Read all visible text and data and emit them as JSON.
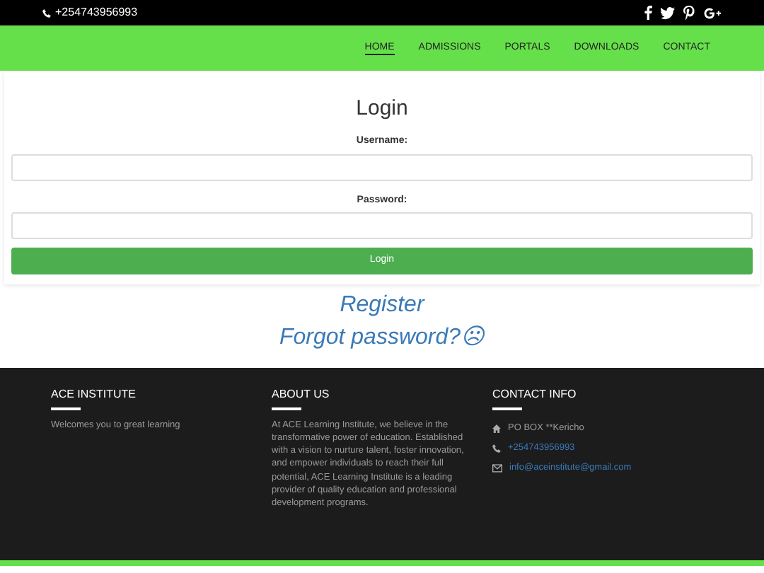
{
  "top_bar": {
    "phone": "+254743956993"
  },
  "nav": [
    {
      "label": "HOME",
      "selected": true
    },
    {
      "label": "ADMISSIONS",
      "selected": false
    },
    {
      "label": "PORTALS",
      "selected": false
    },
    {
      "label": "DOWNLOADS",
      "selected": false
    },
    {
      "label": "CONTACT",
      "selected": false
    }
  ],
  "login": {
    "title": "Login",
    "fields": [
      {
        "label": "Username:"
      },
      {
        "label": "Password:"
      }
    ],
    "button": "Login"
  },
  "links": [
    "Register",
    "Forgot password?☹"
  ],
  "footer": {
    "columns": [
      {
        "title": "ACE INSTITUTE",
        "text": "Welcomes you to great learning"
      },
      {
        "title": "ABOUT US",
        "text": "At ACE Learning Institute, we believe in the transformative power of education. Established with a vision to nurture talent, foster innovation, and empower individuals to reach their full potential, ACE Learning Institute is a leading provider of quality education and professional development programs."
      },
      {
        "title": "CONTACT INFO",
        "items": [
          {
            "kind": "address",
            "text": "PO BOX **Kericho"
          },
          {
            "kind": "phone",
            "text": "+254743956993"
          },
          {
            "kind": "email",
            "text": "info@aceinstitute@gmail.com"
          }
        ]
      }
    ]
  }
}
